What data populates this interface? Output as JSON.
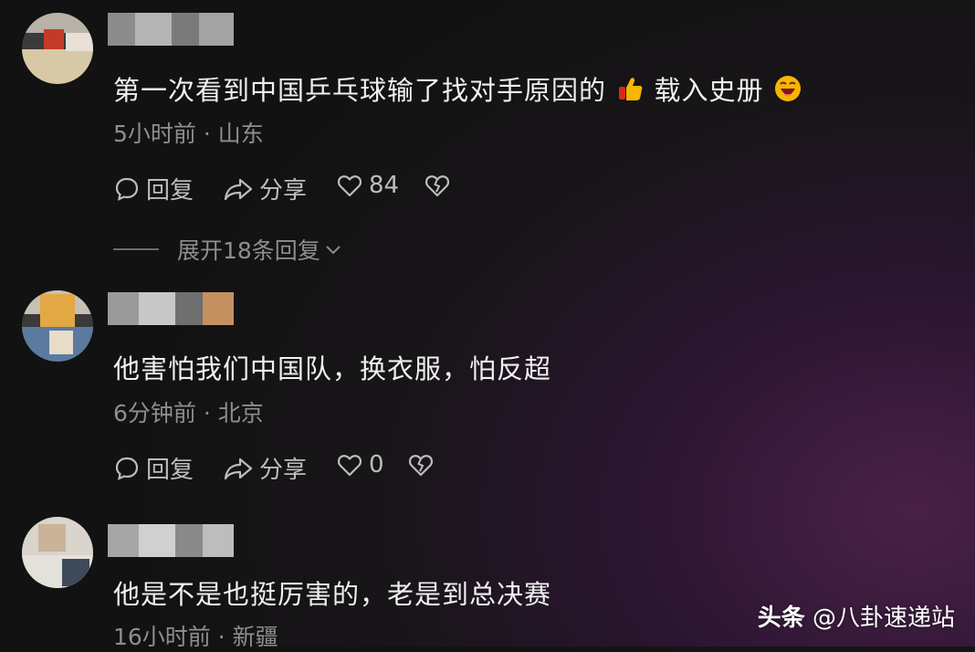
{
  "comments": [
    {
      "text": "第一次看到中国乒乓球输了找对手原因的",
      "text_tail": "载入史册",
      "time": "5小时前",
      "location": "山东",
      "reply_label": "回复",
      "share_label": "分享",
      "likes": "84",
      "expand_label": "展开18条回复"
    },
    {
      "text": "他害怕我们中国队，换衣服，怕反超",
      "time": "6分钟前",
      "location": "北京",
      "reply_label": "回复",
      "share_label": "分享",
      "likes": "0"
    },
    {
      "text": "他是不是也挺厉害的，老是到总决赛",
      "time": "16小时前",
      "location": "新疆"
    }
  ],
  "meta_separator": "·",
  "watermark": {
    "brand": "头条",
    "handle": "@八卦速递站"
  },
  "icons": {
    "reply": "reply-bubble-icon",
    "share": "share-arrow-icon",
    "like": "heart-icon",
    "dislike": "broken-heart-icon",
    "expand": "chevron-down-icon",
    "emoji1": "thumbs-up-emoji",
    "emoji2": "laughing-face-emoji"
  },
  "colors": {
    "text": "#f0f0f0",
    "meta": "#8e8e8e",
    "action": "#bdbdbd"
  }
}
